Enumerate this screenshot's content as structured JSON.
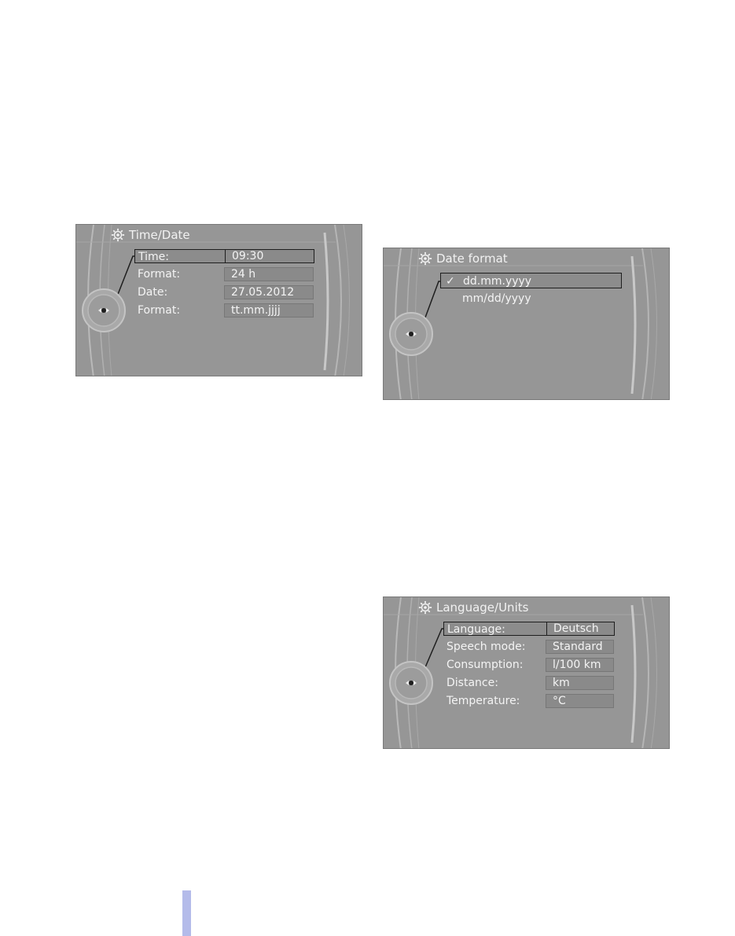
{
  "panels": {
    "time_date": {
      "title": "Time/Date",
      "rows": [
        {
          "label": "Time:",
          "value": "09:30"
        },
        {
          "label": "Format:",
          "value": "24 h"
        },
        {
          "label": "Date:",
          "value": "27.05.2012"
        },
        {
          "label": "Format:",
          "value": "tt.mm.jjjj"
        }
      ]
    },
    "date_format": {
      "title": "Date format",
      "options": [
        {
          "label": "dd.mm.yyyy",
          "checked": true
        },
        {
          "label": "mm/dd/yyyy",
          "checked": false
        }
      ]
    },
    "language_units": {
      "title": "Language/Units",
      "rows": [
        {
          "label": "Language:",
          "value": "Deutsch"
        },
        {
          "label": "Speech mode:",
          "value": "Standard"
        },
        {
          "label": "Consumption:",
          "value": "l/100 km"
        },
        {
          "label": "Distance:",
          "value": "km"
        },
        {
          "label": "Temperature:",
          "value": "°C"
        }
      ]
    }
  },
  "icons": {
    "settings": "gear-icon",
    "controller": "controller-icon",
    "check": "check-icon"
  },
  "colors": {
    "panel_bg": "#969696",
    "value_bg": "#8a8a8a",
    "selection_border": "#1e1e1e",
    "text": "#f4f4f4",
    "side_bar": "#b4bbea"
  }
}
